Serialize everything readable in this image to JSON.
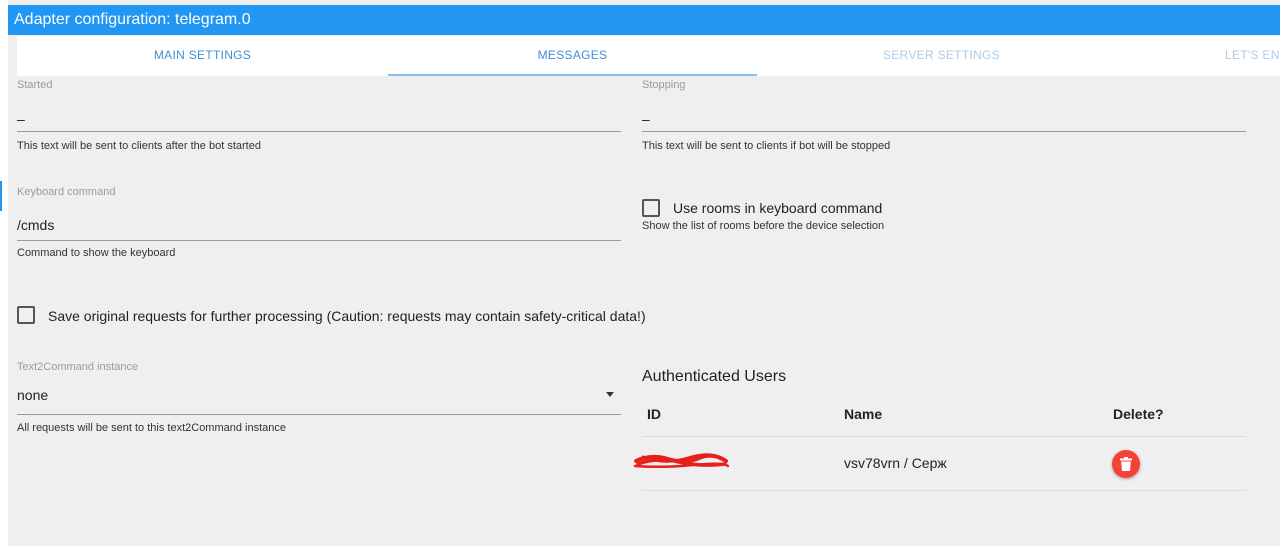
{
  "window": {
    "title": "Adapter configuration: telegram.0"
  },
  "tabs": [
    {
      "label": "MAIN SETTINGS"
    },
    {
      "label": "MESSAGES"
    },
    {
      "label": "SERVER SETTINGS"
    },
    {
      "label": "LET'S ENC"
    }
  ],
  "started": {
    "label": "Started",
    "value": "–",
    "help": "This text will be sent to clients after the bot started"
  },
  "stopping": {
    "label": "Stopping",
    "value": "–",
    "help": "This text will be sent to clients if bot will be stopped"
  },
  "keyboard": {
    "label": "Keyboard command",
    "value": "/cmds",
    "help": "Command to show the keyboard"
  },
  "use_rooms": {
    "label": "Use rooms in keyboard command",
    "help": "Show the list of rooms before the device selection",
    "checked": false
  },
  "save_requests": {
    "label": "Save original requests for further processing (Caution: requests may contain safety-critical data!)",
    "checked": false
  },
  "text2command": {
    "label": "Text2Command instance",
    "value": "none",
    "help": "All requests will be sent to this text2Command instance"
  },
  "auth_users": {
    "title": "Authenticated Users",
    "columns": {
      "id": "ID",
      "name": "Name",
      "delete": "Delete?"
    },
    "rows": [
      {
        "id": "",
        "name": "vsv78vrn / Серж"
      }
    ]
  },
  "colors": {
    "accent": "#2196f3",
    "delete": "#f44336",
    "redaction": "#e8201a"
  },
  "icons": {
    "delete": "trash-icon",
    "dropdown": "caret-down-icon"
  }
}
